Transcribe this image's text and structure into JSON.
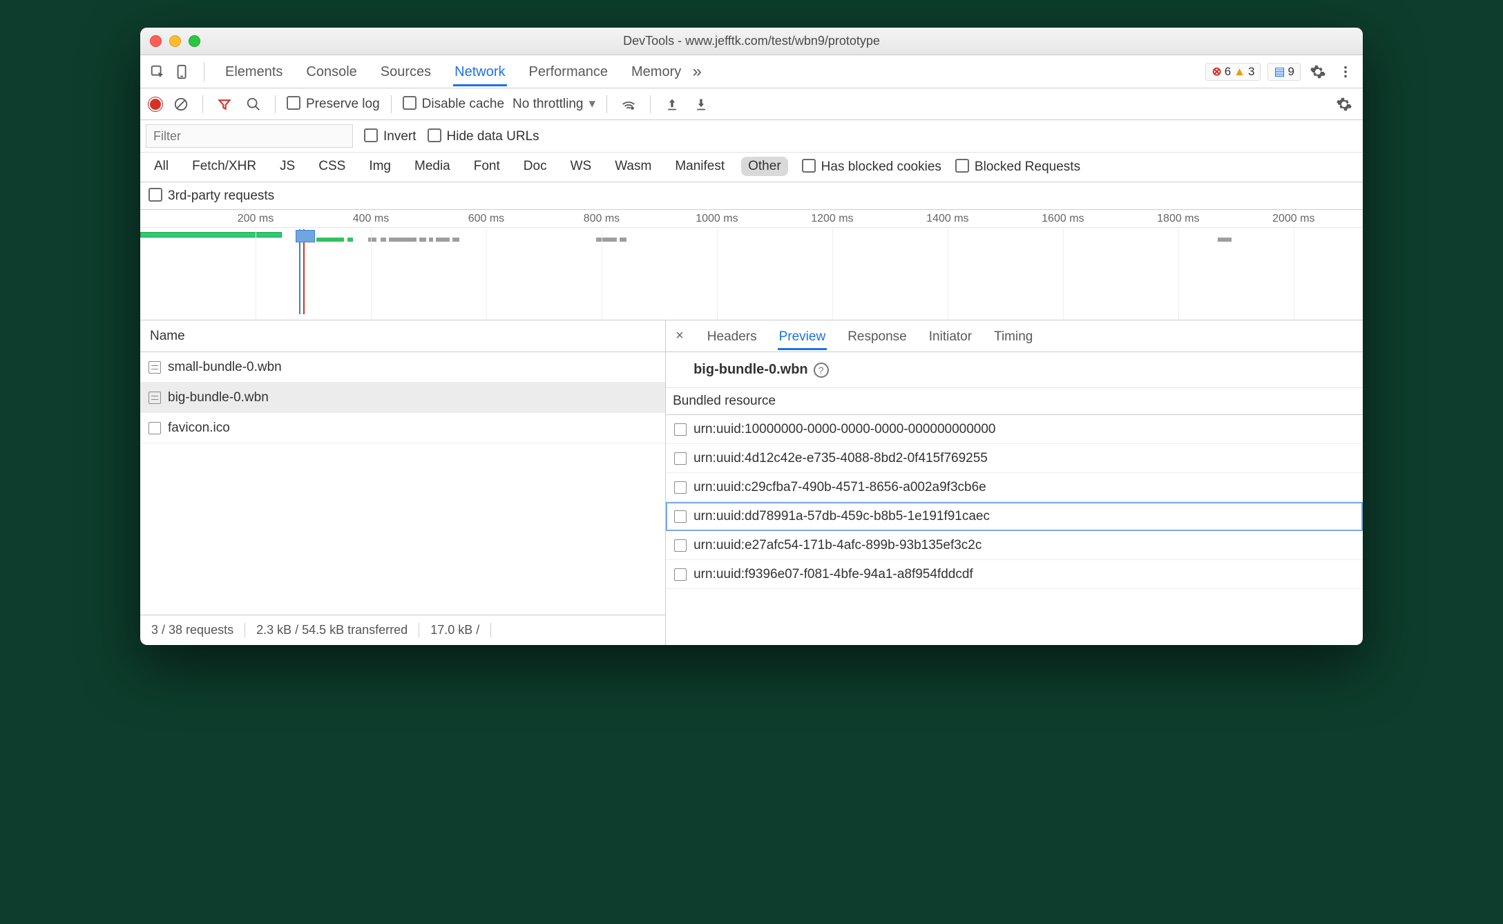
{
  "window": {
    "title": "DevTools - www.jefftk.com/test/wbn9/prototype"
  },
  "main_tabs": [
    "Elements",
    "Console",
    "Sources",
    "Network",
    "Performance",
    "Memory"
  ],
  "main_tab_active": "Network",
  "badges": {
    "errors": "6",
    "warnings": "3",
    "messages": "9"
  },
  "toolbar": {
    "preserve_log": "Preserve log",
    "disable_cache": "Disable cache",
    "throttling": "No throttling"
  },
  "filter": {
    "placeholder": "Filter",
    "invert": "Invert",
    "hide_data_urls": "Hide data URLs"
  },
  "types": [
    "All",
    "Fetch/XHR",
    "JS",
    "CSS",
    "Img",
    "Media",
    "Font",
    "Doc",
    "WS",
    "Wasm",
    "Manifest",
    "Other"
  ],
  "type_active": "Other",
  "type_checks": {
    "has_blocked_cookies": "Has blocked cookies",
    "blocked_requests": "Blocked Requests",
    "third_party": "3rd-party requests"
  },
  "timeline": {
    "ticks": [
      "200 ms",
      "400 ms",
      "600 ms",
      "800 ms",
      "1000 ms",
      "1200 ms",
      "1400 ms",
      "1600 ms",
      "1800 ms",
      "2000 ms"
    ]
  },
  "requests": {
    "header": "Name",
    "rows": [
      {
        "name": "small-bundle-0.wbn",
        "icon": "doc",
        "selected": false
      },
      {
        "name": "big-bundle-0.wbn",
        "icon": "doc",
        "selected": true
      },
      {
        "name": "favicon.ico",
        "icon": "blank",
        "selected": false
      }
    ],
    "status": [
      "3 / 38 requests",
      "2.3 kB / 54.5 kB transferred",
      "17.0 kB /"
    ]
  },
  "detail_tabs": [
    "Headers",
    "Preview",
    "Response",
    "Initiator",
    "Timing"
  ],
  "detail_tab_active": "Preview",
  "preview": {
    "title": "big-bundle-0.wbn",
    "section": "Bundled resource",
    "resources": [
      "urn:uuid:10000000-0000-0000-0000-000000000000",
      "urn:uuid:4d12c42e-e735-4088-8bd2-0f415f769255",
      "urn:uuid:c29cfba7-490b-4571-8656-a002a9f3cb6e",
      "urn:uuid:dd78991a-57db-459c-b8b5-1e191f91caec",
      "urn:uuid:e27afc54-171b-4afc-899b-93b135ef3c2c",
      "urn:uuid:f9396e07-f081-4bfe-94a1-a8f954fddcdf"
    ],
    "focused_index": 3
  }
}
